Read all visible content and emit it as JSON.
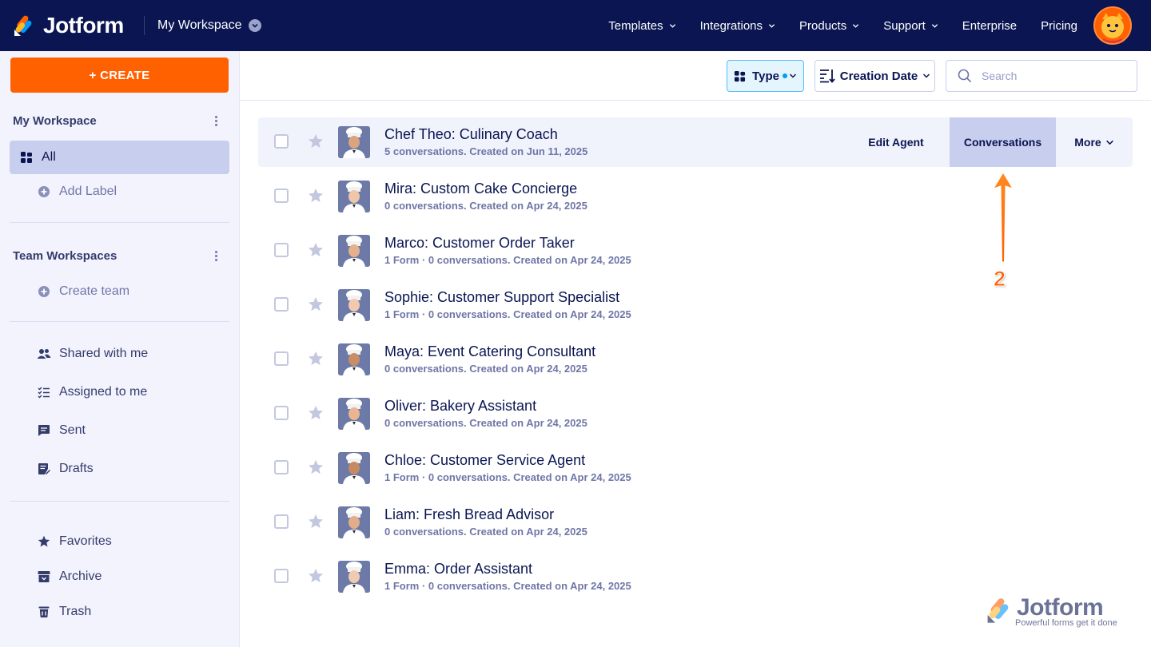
{
  "brand": {
    "name": "Jotform",
    "colors": {
      "navy": "#0a1551",
      "orange": "#ff6100",
      "yellow": "#ffb629",
      "blue": "#0099ff"
    }
  },
  "topbar": {
    "workspace_label": "My Workspace",
    "nav": [
      {
        "label": "Templates",
        "has_dropdown": true
      },
      {
        "label": "Integrations",
        "has_dropdown": true
      },
      {
        "label": "Products",
        "has_dropdown": true
      },
      {
        "label": "Support",
        "has_dropdown": true
      },
      {
        "label": "Enterprise",
        "has_dropdown": false
      },
      {
        "label": "Pricing",
        "has_dropdown": false
      }
    ]
  },
  "sidebar": {
    "create_label": "+ CREATE",
    "my_workspace": {
      "title": "My Workspace",
      "items": [
        {
          "label": "All",
          "icon": "grid-icon",
          "active": true
        },
        {
          "label": "Add Label",
          "icon": "plus-circle-icon"
        }
      ]
    },
    "team_workspaces": {
      "title": "Team Workspaces",
      "items": [
        {
          "label": "Create team",
          "icon": "plus-circle-icon"
        }
      ]
    },
    "folders": [
      {
        "label": "Shared with me",
        "icon": "users-icon"
      },
      {
        "label": "Assigned to me",
        "icon": "checklist-icon"
      },
      {
        "label": "Sent",
        "icon": "message-icon"
      },
      {
        "label": "Drafts",
        "icon": "draft-icon"
      }
    ],
    "bottom": [
      {
        "label": "Favorites",
        "icon": "star-icon"
      },
      {
        "label": "Archive",
        "icon": "archive-icon"
      },
      {
        "label": "Trash",
        "icon": "trash-icon"
      }
    ]
  },
  "toolbar": {
    "type_label": "Type",
    "sort_label": "Creation Date",
    "search_placeholder": "Search"
  },
  "agents": [
    {
      "title": "Chef Theo: Culinary Coach",
      "meta": "5 conversations. Created on Jun 11, 2025"
    },
    {
      "title": "Mira: Custom Cake Concierge",
      "meta": "0 conversations. Created on Apr 24, 2025"
    },
    {
      "title": "Marco: Customer Order Taker",
      "meta": "1 Form · 0 conversations. Created on Apr 24, 2025"
    },
    {
      "title": "Sophie: Customer Support Specialist",
      "meta": "1 Form · 0 conversations. Created on Apr 24, 2025"
    },
    {
      "title": "Maya: Event Catering Consultant",
      "meta": "0 conversations. Created on Apr 24, 2025"
    },
    {
      "title": "Oliver: Bakery Assistant",
      "meta": "0 conversations. Created on Apr 24, 2025"
    },
    {
      "title": "Chloe: Customer Service Agent",
      "meta": "1 Form · 0 conversations. Created on Apr 24, 2025"
    },
    {
      "title": "Liam: Fresh Bread Advisor",
      "meta": "0 conversations. Created on Apr 24, 2025"
    },
    {
      "title": "Emma: Order Assistant",
      "meta": "1 Form · 0 conversations. Created on Apr 24, 2025"
    }
  ],
  "row_actions": {
    "edit_label": "Edit Agent",
    "conversations_label": "Conversations",
    "more_label": "More"
  },
  "annotation": {
    "step_number": "2"
  },
  "watermark": {
    "name": "Jotform",
    "tagline": "Powerful forms get it done"
  }
}
